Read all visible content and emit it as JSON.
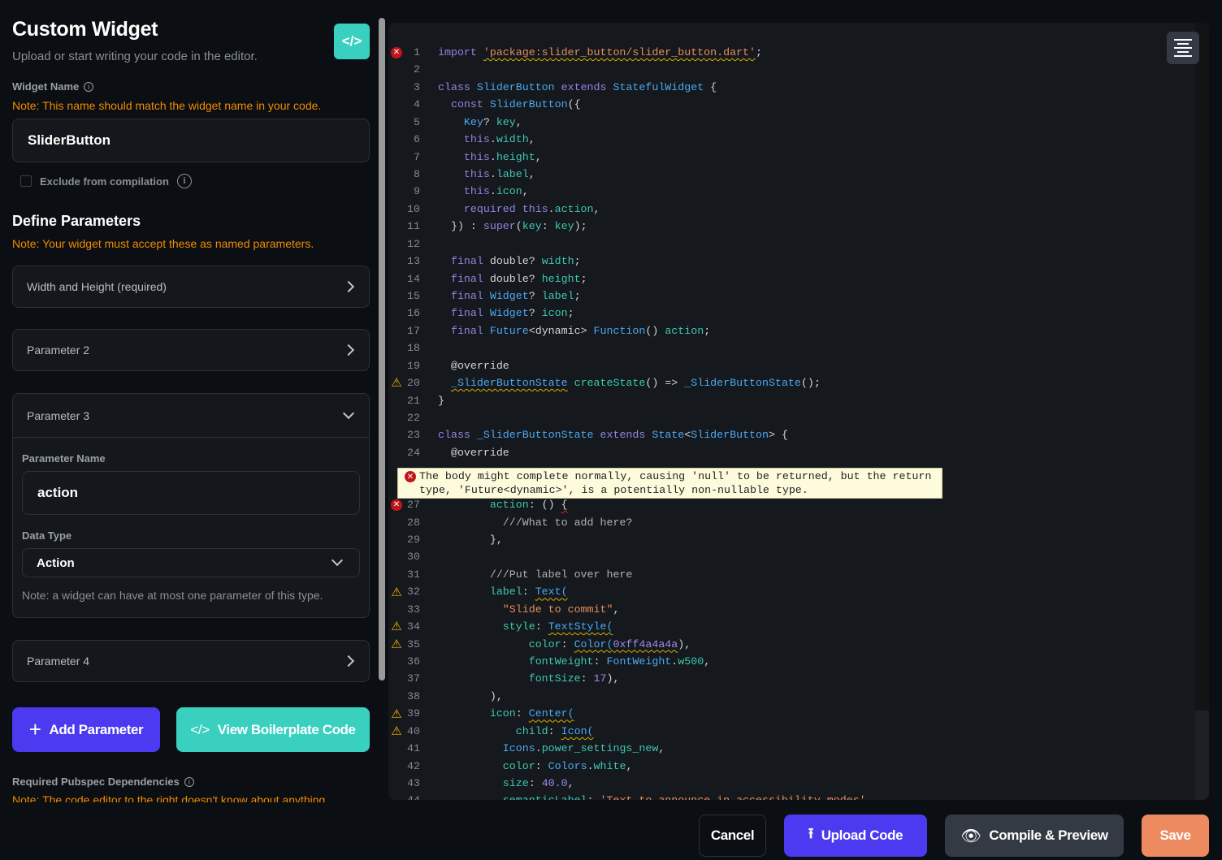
{
  "header": {
    "title": "Custom Widget",
    "subtitle": "Upload or start writing your code in the editor.",
    "code_icon": "</>"
  },
  "widget_name": {
    "label": "Widget Name",
    "note": "Note: This name should match the widget name in your code.",
    "value": "SliderButton"
  },
  "exclude": {
    "label": "Exclude from compilation",
    "checked": false
  },
  "parameters": {
    "title": "Define Parameters",
    "note": "Note: Your widget must accept these as named parameters.",
    "items": [
      {
        "label": "Width and Height (required)",
        "expanded": false
      },
      {
        "label": "Parameter 2",
        "expanded": false
      },
      {
        "label": "Parameter 3",
        "expanded": true
      },
      {
        "label": "Parameter 4",
        "expanded": false
      }
    ],
    "expanded": {
      "name_label": "Parameter Name",
      "name_value": "action",
      "type_label": "Data Type",
      "type_value": "Action",
      "type_note": "Note: a widget can have at most one parameter of this type."
    }
  },
  "buttons": {
    "add_parameter": "Add Parameter",
    "view_boilerplate": "View Boilerplate Code",
    "cancel": "Cancel",
    "upload": "Upload Code",
    "compile": "Compile & Preview",
    "save": "Save"
  },
  "pubspec": {
    "label": "Required Pubspec Dependencies",
    "note": "Note: The code editor to the right doesn't know about anything"
  },
  "colors": {
    "primary": "#4b3aef",
    "teal": "#39d0c0",
    "save": "#ee8a60",
    "note": "#f08c00"
  },
  "editor": {
    "tooltip": "The body might complete normally, causing 'null' to be returned, but the return type, 'Future<dynamic>', is a potentially non-nullable type.",
    "lines": [
      {
        "n": 1,
        "m": "err",
        "t": [
          [
            "k",
            "import "
          ],
          [
            "s w",
            "'package:slider_button/slider_button.dart'"
          ],
          [
            "d",
            ";"
          ]
        ]
      },
      {
        "n": 2,
        "t": []
      },
      {
        "n": 3,
        "t": [
          [
            "k",
            "class "
          ],
          [
            "t",
            "SliderButton "
          ],
          [
            "k",
            "extends "
          ],
          [
            "t",
            "StatefulWidget "
          ],
          [
            "d",
            "{"
          ]
        ]
      },
      {
        "n": 4,
        "t": [
          [
            "k",
            "  const "
          ],
          [
            "t",
            "SliderButton"
          ],
          [
            "d",
            "({"
          ]
        ]
      },
      {
        "n": 5,
        "t": [
          [
            "t",
            "    Key"
          ],
          [
            "d",
            "? "
          ],
          [
            "p",
            "key"
          ],
          [
            "d",
            ","
          ]
        ]
      },
      {
        "n": 6,
        "t": [
          [
            "k",
            "    this"
          ],
          [
            "d",
            "."
          ],
          [
            "p",
            "width"
          ],
          [
            "d",
            ","
          ]
        ]
      },
      {
        "n": 7,
        "t": [
          [
            "k",
            "    this"
          ],
          [
            "d",
            "."
          ],
          [
            "p",
            "height"
          ],
          [
            "d",
            ","
          ]
        ]
      },
      {
        "n": 8,
        "t": [
          [
            "k",
            "    this"
          ],
          [
            "d",
            "."
          ],
          [
            "p",
            "label"
          ],
          [
            "d",
            ","
          ]
        ]
      },
      {
        "n": 9,
        "t": [
          [
            "k",
            "    this"
          ],
          [
            "d",
            "."
          ],
          [
            "p",
            "icon"
          ],
          [
            "d",
            ","
          ]
        ]
      },
      {
        "n": 10,
        "t": [
          [
            "k",
            "    required this"
          ],
          [
            "d",
            "."
          ],
          [
            "p",
            "action"
          ],
          [
            "d",
            ","
          ]
        ]
      },
      {
        "n": 11,
        "t": [
          [
            "d",
            "  }) : "
          ],
          [
            "k",
            "super"
          ],
          [
            "d",
            "("
          ],
          [
            "p",
            "key"
          ],
          [
            "d",
            ": "
          ],
          [
            "p",
            "key"
          ],
          [
            "d",
            ");"
          ]
        ]
      },
      {
        "n": 12,
        "t": []
      },
      {
        "n": 13,
        "t": [
          [
            "k",
            "  final "
          ],
          [
            "d",
            "double? "
          ],
          [
            "p",
            "width"
          ],
          [
            "d",
            ";"
          ]
        ]
      },
      {
        "n": 14,
        "t": [
          [
            "k",
            "  final "
          ],
          [
            "d",
            "double? "
          ],
          [
            "p",
            "height"
          ],
          [
            "d",
            ";"
          ]
        ]
      },
      {
        "n": 15,
        "t": [
          [
            "k",
            "  final "
          ],
          [
            "t",
            "Widget"
          ],
          [
            "d",
            "? "
          ],
          [
            "p",
            "label"
          ],
          [
            "d",
            ";"
          ]
        ]
      },
      {
        "n": 16,
        "t": [
          [
            "k",
            "  final "
          ],
          [
            "t",
            "Widget"
          ],
          [
            "d",
            "? "
          ],
          [
            "p",
            "icon"
          ],
          [
            "d",
            ";"
          ]
        ]
      },
      {
        "n": 17,
        "t": [
          [
            "k",
            "  final "
          ],
          [
            "t",
            "Future"
          ],
          [
            "d",
            "<dynamic> "
          ],
          [
            "t",
            "Function"
          ],
          [
            "d",
            "() "
          ],
          [
            "p",
            "action"
          ],
          [
            "d",
            ";"
          ]
        ]
      },
      {
        "n": 18,
        "t": []
      },
      {
        "n": 19,
        "t": [
          [
            "d",
            "  @override"
          ]
        ]
      },
      {
        "n": 20,
        "m": "warn",
        "t": [
          [
            "d",
            "  "
          ],
          [
            "t w",
            "_SliderButtonState"
          ],
          [
            "p",
            " createState"
          ],
          [
            "d",
            "() => "
          ],
          [
            "t",
            "_SliderButtonState"
          ],
          [
            "d",
            "();"
          ]
        ]
      },
      {
        "n": 21,
        "t": [
          [
            "d",
            "}"
          ]
        ]
      },
      {
        "n": 22,
        "t": []
      },
      {
        "n": 23,
        "t": [
          [
            "k",
            "class "
          ],
          [
            "t",
            "_SliderButtonState "
          ],
          [
            "k",
            "extends "
          ],
          [
            "t",
            "State"
          ],
          [
            "d",
            "<"
          ],
          [
            "t",
            "SliderButton"
          ],
          [
            "d",
            "> {"
          ]
        ]
      },
      {
        "n": 24,
        "t": [
          [
            "d",
            "  @override"
          ]
        ]
      },
      {
        "n": 27,
        "m": "err",
        "t": [
          [
            "p",
            "        action"
          ],
          [
            "d",
            ": () "
          ],
          [
            "d e",
            "{"
          ]
        ]
      },
      {
        "n": 28,
        "t": [
          [
            "c",
            "          ///What to add here?"
          ]
        ]
      },
      {
        "n": 29,
        "t": [
          [
            "d",
            "        },"
          ]
        ]
      },
      {
        "n": 30,
        "t": []
      },
      {
        "n": 31,
        "t": [
          [
            "c",
            "        ///Put label over here"
          ]
        ]
      },
      {
        "n": 32,
        "m": "warn",
        "t": [
          [
            "p",
            "        label"
          ],
          [
            "d",
            ": "
          ],
          [
            "t w",
            "Text("
          ]
        ]
      },
      {
        "n": 33,
        "t": [
          [
            "s",
            "          \"Slide to commit\""
          ],
          [
            "d",
            ","
          ]
        ]
      },
      {
        "n": 34,
        "m": "warn",
        "t": [
          [
            "p",
            "          style"
          ],
          [
            "d",
            ": "
          ],
          [
            "t w",
            "TextStyle("
          ]
        ]
      },
      {
        "n": 35,
        "m": "warn",
        "t": [
          [
            "p",
            "              color"
          ],
          [
            "d",
            ": "
          ],
          [
            "t w",
            "Color("
          ],
          [
            "n w",
            "0xff4a4a4a"
          ],
          [
            "d",
            "),"
          ]
        ]
      },
      {
        "n": 36,
        "t": [
          [
            "p",
            "              fontWeight"
          ],
          [
            "d",
            ": "
          ],
          [
            "t",
            "FontWeight"
          ],
          [
            "d",
            "."
          ],
          [
            "p",
            "w500"
          ],
          [
            "d",
            ","
          ]
        ]
      },
      {
        "n": 37,
        "t": [
          [
            "p",
            "              fontSize"
          ],
          [
            "d",
            ": "
          ],
          [
            "n",
            "17"
          ],
          [
            "d",
            "),"
          ]
        ]
      },
      {
        "n": 38,
        "t": [
          [
            "d",
            "        ),"
          ]
        ]
      },
      {
        "n": 39,
        "m": "warn",
        "t": [
          [
            "p",
            "        icon"
          ],
          [
            "d",
            ": "
          ],
          [
            "t w",
            "Center("
          ]
        ]
      },
      {
        "n": 40,
        "m": "warn",
        "t": [
          [
            "p",
            "            child"
          ],
          [
            "d",
            ": "
          ],
          [
            "t w",
            "Icon("
          ]
        ]
      },
      {
        "n": 41,
        "t": [
          [
            "t",
            "          Icons"
          ],
          [
            "d",
            "."
          ],
          [
            "p",
            "power_settings_new"
          ],
          [
            "d",
            ","
          ]
        ]
      },
      {
        "n": 42,
        "t": [
          [
            "p",
            "          color"
          ],
          [
            "d",
            ": "
          ],
          [
            "t",
            "Colors"
          ],
          [
            "d",
            "."
          ],
          [
            "p",
            "white"
          ],
          [
            "d",
            ","
          ]
        ]
      },
      {
        "n": 43,
        "t": [
          [
            "p",
            "          size"
          ],
          [
            "d",
            ": "
          ],
          [
            "n",
            "40.0"
          ],
          [
            "d",
            ","
          ]
        ]
      },
      {
        "n": 44,
        "t": [
          [
            "p",
            "          semanticLabel"
          ],
          [
            "d",
            ": "
          ],
          [
            "s",
            "'Text to announce in accessibility modes'"
          ],
          [
            "d",
            ","
          ]
        ]
      }
    ]
  }
}
